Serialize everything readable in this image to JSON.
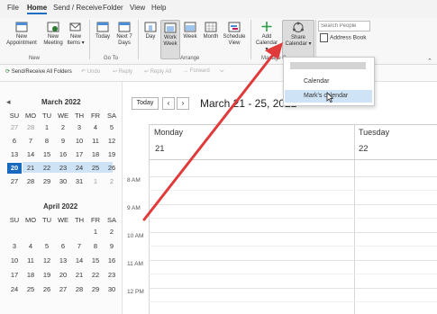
{
  "menu": {
    "items": [
      "File",
      "Home",
      "Send / Receive",
      "Folder",
      "View",
      "Help"
    ],
    "active": "Home"
  },
  "ribbon": {
    "new_appointment": "New Appointment",
    "new_meeting": "New Meeting",
    "new_items": "New Items",
    "today": "Today",
    "next7": "Next 7 Days",
    "day": "Day",
    "work_week": "Work Week",
    "week": "Week",
    "month": "Month",
    "schedule_view": "Schedule View",
    "add_calendar": "Add Calendar",
    "share_calendar": "Share Calendar",
    "search_people_placeholder": "Search People",
    "address_book": "Address Book",
    "groups": {
      "new": "New",
      "goto": "Go To",
      "arrange": "Arrange",
      "manage": "Manage C"
    }
  },
  "qat": {
    "send_receive": "Send/Receive All Folders",
    "undo": "Undo",
    "reply": "Reply",
    "reply_all": "Reply All",
    "forward": "Forward"
  },
  "share_dropdown": {
    "items": [
      "Calendar",
      "Mark's calendar"
    ]
  },
  "mini_cal_march": {
    "title": "March 2022",
    "days": [
      "SU",
      "MO",
      "TU",
      "WE",
      "TH",
      "FR",
      "SA"
    ],
    "weeks": [
      [
        "27",
        "28",
        "1",
        "2",
        "3",
        "4",
        "5"
      ],
      [
        "6",
        "7",
        "8",
        "9",
        "10",
        "11",
        "12"
      ],
      [
        "13",
        "14",
        "15",
        "16",
        "17",
        "18",
        "19"
      ],
      [
        "20",
        "21",
        "22",
        "23",
        "24",
        "25",
        "26"
      ],
      [
        "27",
        "28",
        "29",
        "30",
        "31",
        "1",
        "2"
      ]
    ]
  },
  "mini_cal_april": {
    "title": "April 2022",
    "days": [
      "SU",
      "MO",
      "TU",
      "WE",
      "TH",
      "FR",
      "SA"
    ],
    "weeks": [
      [
        "",
        "",
        "",
        "",
        "",
        "1",
        "2"
      ],
      [
        "3",
        "4",
        "5",
        "6",
        "7",
        "8",
        "9"
      ],
      [
        "10",
        "11",
        "12",
        "13",
        "14",
        "15",
        "16"
      ],
      [
        "17",
        "18",
        "19",
        "20",
        "21",
        "22",
        "23"
      ],
      [
        "24",
        "25",
        "26",
        "27",
        "28",
        "29",
        "30"
      ]
    ]
  },
  "main": {
    "today_button": "Today",
    "date_range": "March 21 - 25, 2022",
    "day1_name": "Monday",
    "day1_num": "21",
    "day2_name": "Tuesday",
    "day2_num": "22",
    "hours": [
      "8 AM",
      "9 AM",
      "10 AM",
      "11 AM",
      "12 PM"
    ]
  },
  "colors": {
    "accent": "#1769c0",
    "arrow": "#e03a3a"
  }
}
